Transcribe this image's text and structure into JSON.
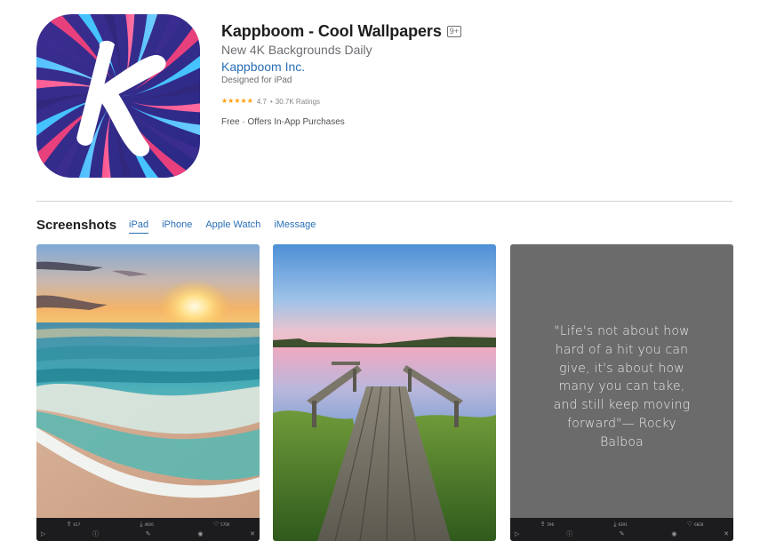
{
  "app": {
    "title": "Kappboom - Cool Wallpapers",
    "age_rating": "9+",
    "subtitle": "New 4K Backgrounds Daily",
    "developer": "Kappboom Inc.",
    "designed_for": "Designed for iPad",
    "rating": "4.7",
    "rating_separator": "•",
    "ratings_count": "30.7K Ratings",
    "stars_filled": 4.7,
    "star_glyph": "★",
    "price": "Free · Offers In-App Purchases",
    "icon_letter": "K"
  },
  "screenshots": {
    "heading": "Screenshots",
    "tabs": [
      {
        "label": "iPad",
        "active": true
      },
      {
        "label": "iPhone",
        "active": false
      },
      {
        "label": "Apple Watch",
        "active": false
      },
      {
        "label": "iMessage",
        "active": false
      }
    ],
    "items": [
      {
        "id": "beach-sunset",
        "bar_counts": [
          "617",
          "4920",
          "5700"
        ],
        "bar_sub": [
          "Shares",
          "Downloads",
          "Likes"
        ]
      },
      {
        "id": "lake-dock",
        "bar_counts": [],
        "bar_sub": []
      },
      {
        "id": "rocky-quote",
        "quote": "\"Life's not about how hard of a hit you can give, it's about how many you can take, and still keep moving forward\"— Rocky Balboa",
        "bar_counts": [
          "596",
          "6391",
          "6828"
        ],
        "bar_sub": [
          "Shares",
          "Downloads",
          "Likes"
        ]
      }
    ]
  },
  "icons": {
    "share": "share-icon",
    "download": "download-icon",
    "like": "heart-icon",
    "play": "play-icon",
    "info": "info-icon",
    "edit": "edit-icon",
    "eye": "eye-icon",
    "close": "close-icon"
  },
  "colors": {
    "link": "#2a6fb5",
    "star": "#ff9f0a",
    "title": "#1d1d1f",
    "secondary": "#6e6e73"
  }
}
